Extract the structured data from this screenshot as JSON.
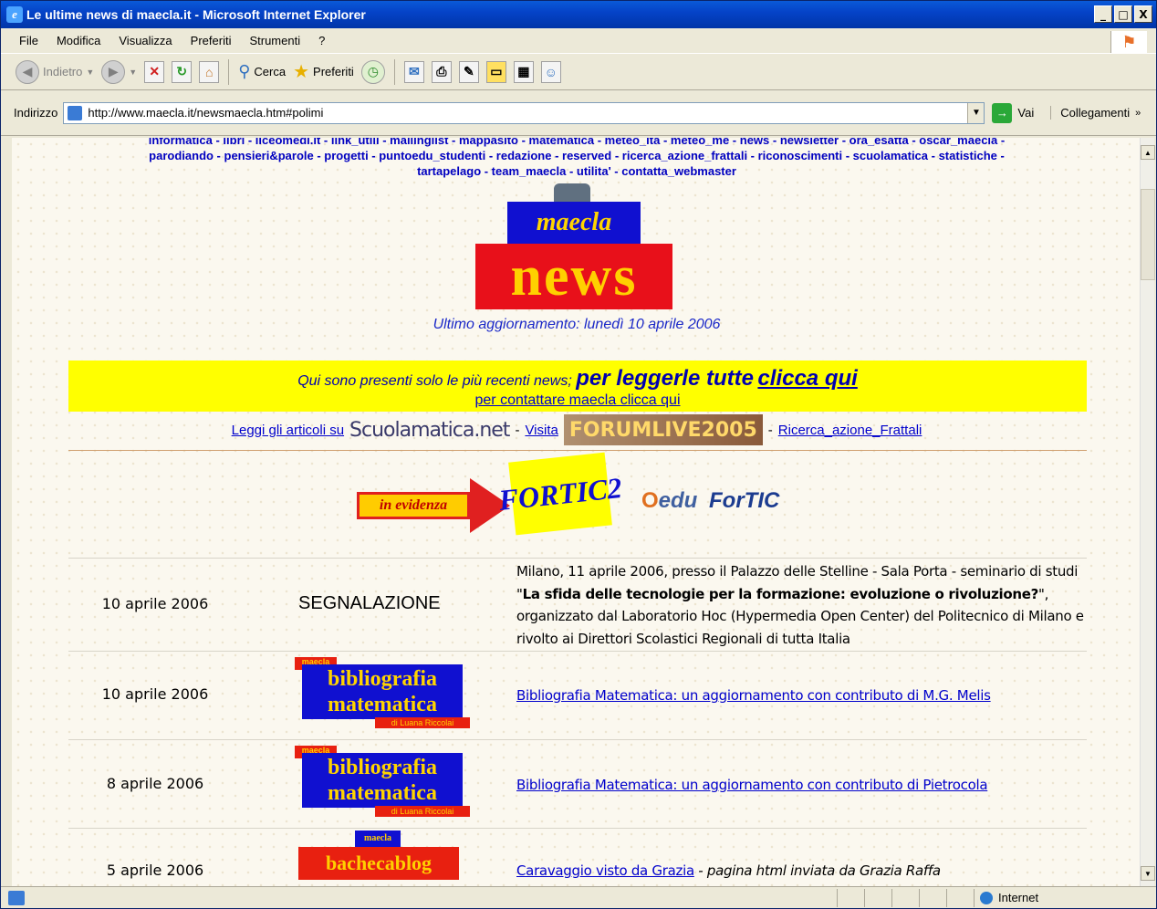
{
  "window": {
    "title": "Le ultime news di maecla.it - Microsoft Internet Explorer"
  },
  "menu": [
    "File",
    "Modifica",
    "Visualizza",
    "Preferiti",
    "Strumenti",
    "?"
  ],
  "toolbar": {
    "back": "Indietro",
    "search": "Cerca",
    "favorites": "Preferiti"
  },
  "address": {
    "label": "Indirizzo",
    "url": "http://www.maecla.it/newsmaecla.htm#polimi",
    "go": "Vai",
    "links": "Collegamenti"
  },
  "page": {
    "navlines": [
      "informatica - libri - liceomedi.it - link_utili - mailinglist - mappasito - matematica - meteo_ita - meteo_me - news - newsletter - ora_esatta - oscar_maecla -",
      "parodiando - pensieri&parole - progetti - puntoedu_studenti - redazione - reserved - ricerca_azione_frattali - riconoscimenti - scuolamatica - statistiche -",
      "tartapelago - team_maecla - utilita' - contatta_webmaster"
    ],
    "logo_top": "maecla",
    "logo_bottom": "news",
    "updated": "Ultimo aggiornamento: lunedì 10 aprile 2006",
    "banner": {
      "intro": "Qui sono presenti solo le più recenti news;",
      "big": "per leggerle tutte",
      "link": "clicca qui",
      "contact": "per contattare maecla clicca qui"
    },
    "leggi": {
      "label": "Leggi gli articoli su",
      "scuolamatica": "Scuolamatica.net",
      "visita": "Visita",
      "forum": "FORUMLIVE2005",
      "ricerca": "Ricerca_azione_Frattali",
      "dash1": "-",
      "dash2": "-"
    },
    "evidenza": {
      "label": "in evidenza",
      "fortic": "FORTIC2",
      "edu": "edu",
      "fortic_text": "ForTIC"
    },
    "rows": [
      {
        "date": "10 aprile 2006",
        "label": "SEGNALAZIONE",
        "desc_a": "Milano, 11 aprile 2006, presso il Palazzo delle Stelline - Sala Porta - seminario di studi \"",
        "desc_b": "La sfida delle tecnologie per la formazione: evoluzione o rivoluzione?",
        "desc_c": "\", organizzato dal Laboratorio Hoc (Hypermedia Open Center) del Politecnico di Milano e rivolto ai Direttori Scolastici Regionali di tutta Italia"
      },
      {
        "date": "10 aprile 2006",
        "img_tag": "maecla",
        "img_main": "bibliografia matematica",
        "img_sub": "di Luana Riccolai",
        "link": "Bibliografia Matematica: un aggiornamento con contributo di M.G. Melis"
      },
      {
        "date": "8 aprile 2006",
        "img_tag": "maecla",
        "img_main": "bibliografia matematica",
        "img_sub": "di Luana Riccolai",
        "link": "Bibliografia Matematica: un aggiornamento con contributo di Pietrocola"
      },
      {
        "date": "5 aprile 2006",
        "img_tag": "maecla",
        "img_main": "bachecablog",
        "link": "Caravaggio visto da Grazia",
        "extra": " - pagina html inviata da Grazia Raffa"
      }
    ]
  },
  "status": {
    "zone": "Internet"
  }
}
